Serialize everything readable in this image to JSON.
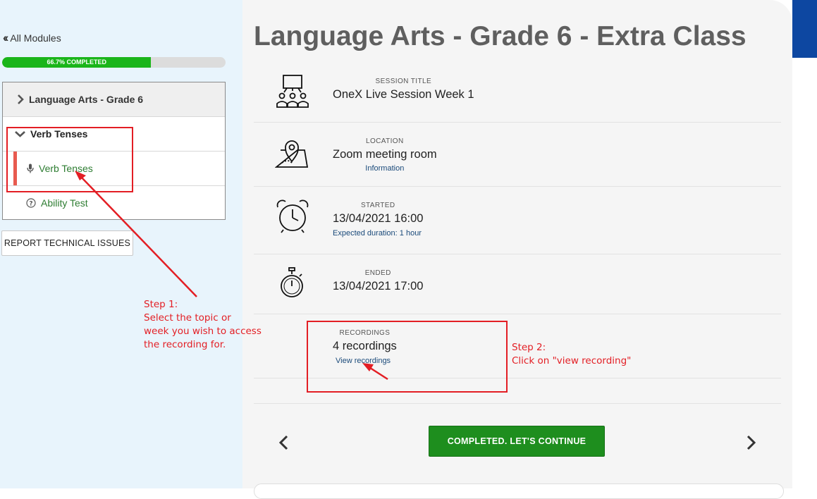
{
  "sidebar": {
    "back_label": "All Modules",
    "progress": {
      "fraction": 0.667,
      "label": "66.7% COMPLETED"
    },
    "tree": {
      "module_label": "Language Arts - Grade 6",
      "topic_label": "Verb Tenses",
      "lesson_label": "Verb Tenses",
      "test_label": "Ability Test"
    },
    "report_button": "REPORT TECHNICAL ISSUES"
  },
  "main": {
    "title": "Language Arts - Grade 6 - Extra Class",
    "session": {
      "label": "SESSION TITLE",
      "value": "OneX Live Session Week 1"
    },
    "location": {
      "label": "LOCATION",
      "value": "Zoom meeting room",
      "sub": "Information"
    },
    "started": {
      "label": "STARTED",
      "value": "13/04/2021 16:00",
      "sub": "Expected duration: 1 hour"
    },
    "ended": {
      "label": "ENDED",
      "value": "13/04/2021 17:00"
    },
    "recordings": {
      "label": "RECORDINGS",
      "value": "4 recordings",
      "link": "View recordings"
    },
    "continue_button": "COMPLETED. LET'S CONTINUE"
  },
  "annotations": {
    "step1": [
      "Step 1:",
      "Select the topic or",
      "week you wish to access",
      "the recording for."
    ],
    "step2": [
      "Step 2:",
      "Click on \"view recording\""
    ]
  },
  "colors": {
    "progress_green": "#1ab51a",
    "continue_green": "#1e8e1e",
    "annotation_red": "#e31e24",
    "active_bar": "#e85a4f",
    "link_green": "#2e7d32"
  },
  "icons": {
    "back": "double-chevron-left-icon",
    "module": "chevron-right-icon",
    "topic": "chevron-down-icon",
    "lesson": "microphone-icon",
    "test": "question-circle-icon",
    "session": "presentation-audience-icon",
    "location": "map-pin-icon",
    "started": "alarm-clock-icon",
    "ended": "stopwatch-icon",
    "prev": "chevron-left-icon",
    "next": "chevron-right-icon"
  }
}
